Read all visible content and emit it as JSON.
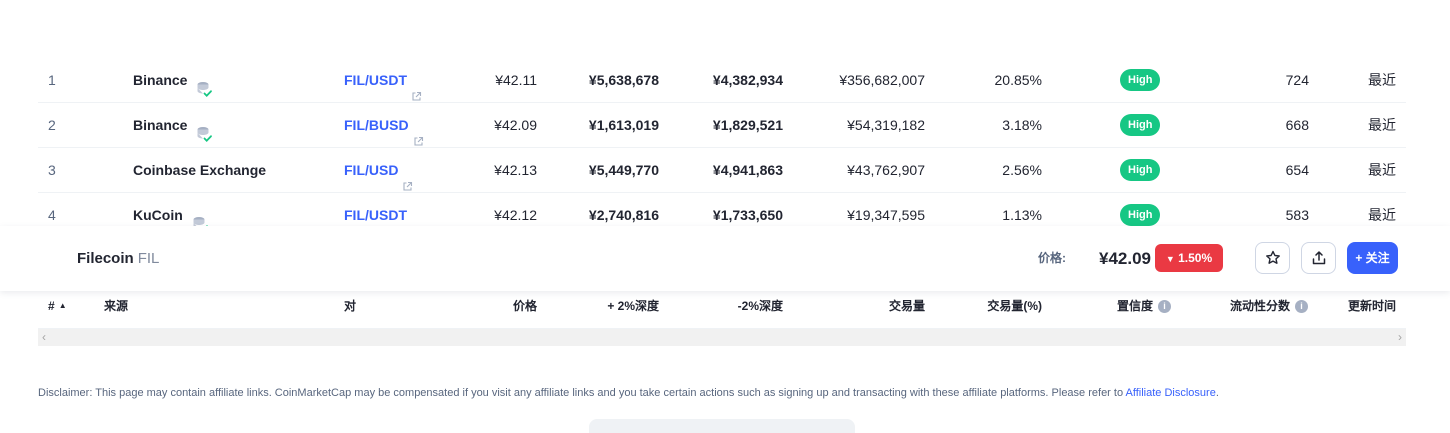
{
  "markets": {
    "rows": [
      {
        "rank": "1",
        "source": "Binance",
        "verified": true,
        "pair": "FIL/USDT",
        "price": "¥42.11",
        "depth_plus": "¥5,638,678",
        "depth_minus": "¥4,382,934",
        "volume": "¥356,682,007",
        "volume_pct": "20.85%",
        "confidence": "High",
        "liquidity": "724",
        "updated": "最近"
      },
      {
        "rank": "2",
        "source": "Binance",
        "verified": true,
        "pair": "FIL/BUSD",
        "price": "¥42.09",
        "depth_plus": "¥1,613,019",
        "depth_minus": "¥1,829,521",
        "volume": "¥54,319,182",
        "volume_pct": "3.18%",
        "confidence": "High",
        "liquidity": "668",
        "updated": "最近"
      },
      {
        "rank": "3",
        "source": "Coinbase Exchange",
        "verified": false,
        "pair": "FIL/USD",
        "price": "¥42.13",
        "depth_plus": "¥5,449,770",
        "depth_minus": "¥4,941,863",
        "volume": "¥43,762,907",
        "volume_pct": "2.56%",
        "confidence": "High",
        "liquidity": "654",
        "updated": "最近"
      },
      {
        "rank": "4",
        "source": "KuCoin",
        "verified": true,
        "pair": "FIL/USDT",
        "price": "¥42.12",
        "depth_plus": "¥2,740,816",
        "depth_minus": "¥1,733,650",
        "volume": "¥19,347,595",
        "volume_pct": "1.13%",
        "confidence": "High",
        "liquidity": "583",
        "updated": "最近"
      }
    ],
    "headers": {
      "rank": "#",
      "source": "来源",
      "pair": "对",
      "price": "价格",
      "depth_plus": "+ 2%深度",
      "depth_minus": "-2%深度",
      "volume": "交易量",
      "volume_pct": "交易量(%)",
      "confidence": "置信度",
      "liquidity": "流动性分数",
      "updated": "更新时间"
    }
  },
  "sticky": {
    "coin_name": "Filecoin",
    "coin_symbol": "FIL",
    "price_label": "价格:",
    "price_value": "¥42.09",
    "change": "1.50%",
    "change_direction": "down",
    "follow_label": "+ 关注"
  },
  "disclaimer": {
    "text": "Disclaimer: This page may contain affiliate links. CoinMarketCap may be compensated if you visit any affiliate links and you take certain actions such as signing up and transacting with these affiliate platforms. Please refer to ",
    "link_text": "Affiliate Disclosure",
    "suffix": "."
  },
  "colors": {
    "positive": "#16c784",
    "negative": "#ea3943",
    "link": "#3861fb"
  }
}
